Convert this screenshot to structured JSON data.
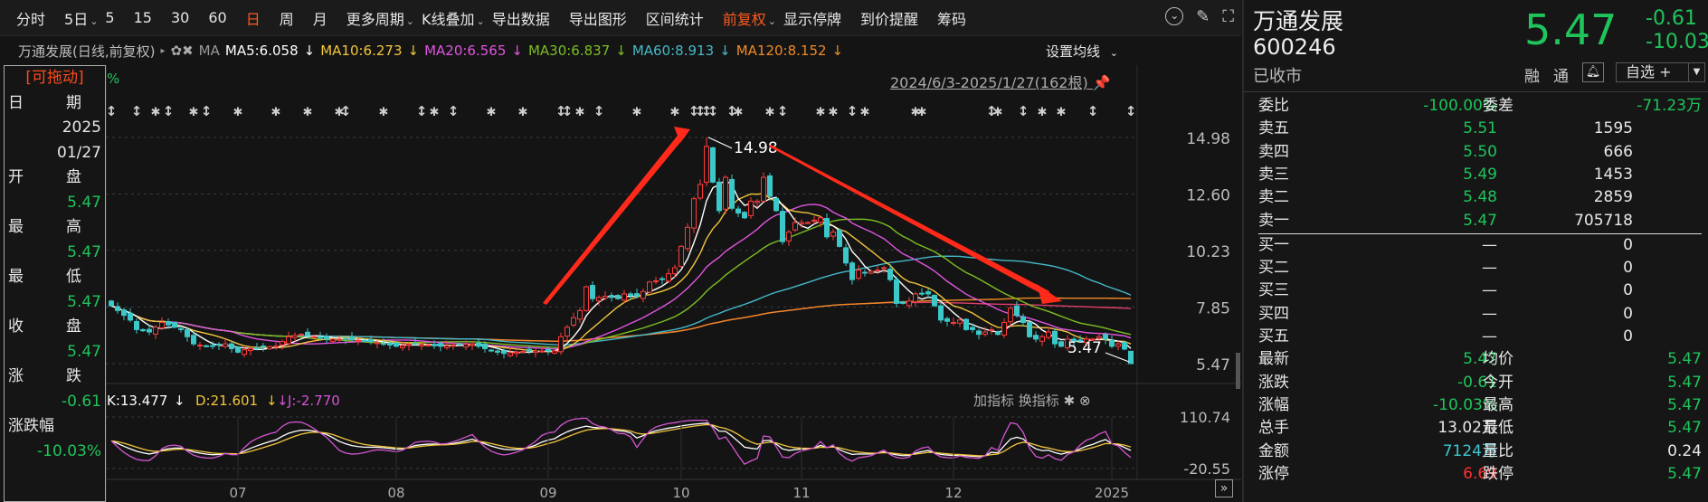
{
  "toolbar": {
    "items": [
      {
        "label": "分时"
      },
      {
        "label": "5日",
        "dropdown": true
      },
      {
        "label": "5"
      },
      {
        "label": "15"
      },
      {
        "label": "30"
      },
      {
        "label": "60"
      },
      {
        "label": "日",
        "active": true
      },
      {
        "label": "周"
      },
      {
        "label": "月"
      },
      {
        "label": "更多周期",
        "dropdown": true
      },
      {
        "label": "K线叠加",
        "dropdown": true
      },
      {
        "label": "导出数据"
      },
      {
        "label": "导出图形"
      },
      {
        "label": "区间统计"
      },
      {
        "label": "前复权",
        "dropdown": true,
        "active": true
      },
      {
        "label": "显示停牌"
      },
      {
        "label": "到价提醒"
      },
      {
        "label": "筹码"
      }
    ],
    "icons": [
      "chevron-circle-icon",
      "brush-icon",
      "fullscreen-icon"
    ]
  },
  "info": {
    "title": "万通发展(日线,前复权)",
    "ma_label": "MA",
    "ma": [
      {
        "label": "MA5:6.058",
        "color": "#ffffff",
        "window": 5
      },
      {
        "label": "MA10:6.273",
        "color": "#f2c53d",
        "window": 10
      },
      {
        "label": "MA20:6.565",
        "color": "#e055e0",
        "window": 20
      },
      {
        "label": "MA30:6.837",
        "color": "#7dbf22",
        "window": 30
      },
      {
        "label": "MA60:8.913",
        "color": "#45b9c9",
        "window": 60
      },
      {
        "label": "MA120:8.152",
        "color": "#f08a24",
        "window": 120
      }
    ],
    "overlay_line_color": "#e0406a",
    "arrow_down": "↓",
    "set_ma": "设置均线",
    "percent_mark": "%",
    "range": "2024/6/3-2025/1/27(162根)"
  },
  "left_panel": {
    "drag_label": "[可拖动]",
    "date_label": [
      "日",
      "期"
    ],
    "date_year": "2025",
    "date_md": "01/27",
    "rows": [
      {
        "label": [
          "开",
          "盘"
        ],
        "value": "5.47"
      },
      {
        "label": [
          "最",
          "高"
        ],
        "value": "5.47"
      },
      {
        "label": [
          "最",
          "低"
        ],
        "value": "5.47"
      },
      {
        "label": [
          "收",
          "盘"
        ],
        "value": "5.47"
      },
      {
        "label": [
          "涨",
          "跌"
        ],
        "value": "-0.61"
      },
      {
        "label": [
          "涨跌幅",
          ""
        ],
        "value": "-10.03%"
      }
    ]
  },
  "chart_data": {
    "type": "candlestick",
    "y_ticks": [
      "14.98",
      "12.60",
      "10.23",
      "7.85",
      "5.47"
    ],
    "y_tick_values": [
      14.98,
      12.6,
      10.23,
      7.85,
      5.47
    ],
    "ylim": [
      5.47,
      14.98
    ],
    "x_ticks": [
      "07",
      "08",
      "09",
      "10",
      "11",
      "12",
      "2025"
    ],
    "x_tick_index": [
      20,
      45,
      69,
      90,
      109,
      133,
      158
    ],
    "annotations": {
      "high": "14.98",
      "low": "5.47"
    },
    "up_color": "#ff3b3b",
    "down_color": "#3cc8c8",
    "closes": [
      7.9,
      7.7,
      7.5,
      7.3,
      6.9,
      6.85,
      6.8,
      7.0,
      7.2,
      7.1,
      7.0,
      6.9,
      6.6,
      6.3,
      6.25,
      6.2,
      6.2,
      6.25,
      6.3,
      6.1,
      5.95,
      6.05,
      6.1,
      6.12,
      6.15,
      6.18,
      6.2,
      6.4,
      6.6,
      6.65,
      6.7,
      6.65,
      6.6,
      6.55,
      6.5,
      6.5,
      6.5,
      6.5,
      6.48,
      6.45,
      6.42,
      6.4,
      6.35,
      6.3,
      6.25,
      6.2,
      6.23,
      6.27,
      6.3,
      6.27,
      6.25,
      6.22,
      6.2,
      6.22,
      6.24,
      6.26,
      6.28,
      6.3,
      6.2,
      6.1,
      6.0,
      5.95,
      5.9,
      5.93,
      5.95,
      5.98,
      6.0,
      6.0,
      6.0,
      6.0,
      6.0,
      6.6,
      7.0,
      7.4,
      7.7,
      8.7,
      8.2,
      8.25,
      8.3,
      8.25,
      8.2,
      8.4,
      8.35,
      8.3,
      8.5,
      8.9,
      8.95,
      9.0,
      9.25,
      9.5,
      10.4,
      11.2,
      12.4,
      13.0,
      14.6,
      13.1,
      11.9,
      13.3,
      12.0,
      11.8,
      11.6,
      12.3,
      12.3,
      13.3,
      12.5,
      11.9,
      10.6,
      11.0,
      11.4,
      11.4,
      11.4,
      11.5,
      11.6,
      10.8,
      11.0,
      10.4,
      9.7,
      9.0,
      9.4,
      9.3,
      9.35,
      9.4,
      9.5,
      9.0,
      8.0,
      8.0,
      8.1,
      8.4,
      8.4,
      8.4,
      7.9,
      7.3,
      7.25,
      7.2,
      7.3,
      6.9,
      6.9,
      6.7,
      6.8,
      6.9,
      6.7,
      7.2,
      7.8,
      7.5,
      7.2,
      6.6,
      6.5,
      6.6,
      6.8,
      6.3,
      6.2,
      6.5,
      6.4,
      6.45,
      6.5,
      6.5,
      6.6,
      6.5,
      6.2,
      6.3,
      6.08,
      5.47
    ],
    "peak_high": 14.98,
    "event_markers": [
      {
        "i": 0,
        "t": "arrow"
      },
      {
        "i": 4,
        "t": "arrow"
      },
      {
        "i": 7,
        "t": "star"
      },
      {
        "i": 9,
        "t": "arrow"
      },
      {
        "i": 13,
        "t": "star"
      },
      {
        "i": 15,
        "t": "arrow"
      },
      {
        "i": 20,
        "t": "star"
      },
      {
        "i": 26,
        "t": "star"
      },
      {
        "i": 31,
        "t": "star"
      },
      {
        "i": 36,
        "t": "star"
      },
      {
        "i": 37,
        "t": "arrow"
      },
      {
        "i": 43,
        "t": "star"
      },
      {
        "i": 49,
        "t": "arrow"
      },
      {
        "i": 51,
        "t": "star"
      },
      {
        "i": 54,
        "t": "arrow"
      },
      {
        "i": 60,
        "t": "star"
      },
      {
        "i": 65,
        "t": "star"
      },
      {
        "i": 71,
        "t": "arrow"
      },
      {
        "i": 72,
        "t": "arrow"
      },
      {
        "i": 74,
        "t": "star"
      },
      {
        "i": 77,
        "t": "arrow"
      },
      {
        "i": 83,
        "t": "star"
      },
      {
        "i": 89,
        "t": "star"
      },
      {
        "i": 92,
        "t": "arrow"
      },
      {
        "i": 93,
        "t": "arrow"
      },
      {
        "i": 94,
        "t": "arrow"
      },
      {
        "i": 95,
        "t": "arrow"
      },
      {
        "i": 98,
        "t": "arrow"
      },
      {
        "i": 99,
        "t": "star"
      },
      {
        "i": 104,
        "t": "star"
      },
      {
        "i": 106,
        "t": "arrow"
      },
      {
        "i": 112,
        "t": "star"
      },
      {
        "i": 114,
        "t": "star"
      },
      {
        "i": 117,
        "t": "arrow"
      },
      {
        "i": 119,
        "t": "star"
      },
      {
        "i": 127,
        "t": "star"
      },
      {
        "i": 128,
        "t": "star"
      },
      {
        "i": 139,
        "t": "arrow"
      },
      {
        "i": 140,
        "t": "star"
      },
      {
        "i": 144,
        "t": "arrow"
      },
      {
        "i": 147,
        "t": "star"
      },
      {
        "i": 150,
        "t": "star"
      },
      {
        "i": 155,
        "t": "arrow"
      },
      {
        "i": 161,
        "t": "arrow"
      }
    ],
    "kdj": {
      "k_label": "K:13.477",
      "d_label": "D:21.601",
      "j_label": "J:-2.770",
      "k_color": "#ffffff",
      "d_color": "#f2c53d",
      "j_color": "#d455d4",
      "y_ticks": [
        "110.74",
        "-20.55"
      ],
      "ylim": [
        -20.55,
        110.74
      ]
    }
  },
  "indicator_buttons": {
    "add": "加指标",
    "switch": "换指标"
  },
  "scroll_button": "»",
  "right_panel": {
    "name": "万通发展",
    "code": "600246",
    "status": "已收市",
    "price": "5.47",
    "change": "-0.61",
    "change_pct": "-10.03%",
    "tags": [
      "融",
      "通"
    ],
    "watchlist": "自选 +",
    "order_book": {
      "ratio_label": "委比",
      "ratio": "-100.00%",
      "diff_label": "委差",
      "diff": "-71.23万",
      "asks": [
        {
          "label": "卖五",
          "price": "5.51",
          "vol": "1595"
        },
        {
          "label": "卖四",
          "price": "5.50",
          "vol": "666"
        },
        {
          "label": "卖三",
          "price": "5.49",
          "vol": "1453"
        },
        {
          "label": "卖二",
          "price": "5.48",
          "vol": "2859"
        },
        {
          "label": "卖一",
          "price": "5.47",
          "vol": "705718"
        }
      ],
      "bids": [
        {
          "label": "买一",
          "price": "—",
          "vol": "0"
        },
        {
          "label": "买二",
          "price": "—",
          "vol": "0"
        },
        {
          "label": "买三",
          "price": "—",
          "vol": "0"
        },
        {
          "label": "买四",
          "price": "—",
          "vol": "0"
        },
        {
          "label": "买五",
          "price": "—",
          "vol": "0"
        }
      ]
    },
    "stats": [
      {
        "l1": "最新",
        "v1": "5.47",
        "c1": "green",
        "l2": "均价",
        "v2": "5.47",
        "c2": "green"
      },
      {
        "l1": "涨跌",
        "v1": "-0.61",
        "c1": "green",
        "l2": "今开",
        "v2": "5.47",
        "c2": "green"
      },
      {
        "l1": "涨幅",
        "v1": "-10.03%",
        "c1": "green",
        "l2": "最高",
        "v2": "5.47",
        "c2": "green"
      },
      {
        "l1": "总手",
        "v1": "13.02万",
        "c1": "white",
        "l2": "最低",
        "v2": "5.47",
        "c2": "green"
      },
      {
        "l1": "金额",
        "v1": "7124万",
        "c1": "cyan",
        "l2": "量比",
        "v2": "0.24",
        "c2": "white"
      },
      {
        "l1": "涨停",
        "v1": "6.69",
        "c1": "red",
        "l2": "跌停",
        "v2": "5.47",
        "c2": "green"
      }
    ]
  }
}
